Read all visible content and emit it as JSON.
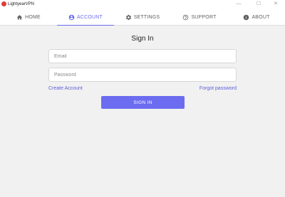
{
  "window": {
    "title": "LightyearVPN",
    "controls": {
      "minimize": "—",
      "maximize": "☐",
      "close": "✕"
    }
  },
  "nav": {
    "tabs": [
      {
        "label": "HOME",
        "icon": "home-icon"
      },
      {
        "label": "ACCOUNT",
        "icon": "account-circle-icon",
        "active": true
      },
      {
        "label": "SETTINGS",
        "icon": "gear-icon"
      },
      {
        "label": "SUPPORT",
        "icon": "help-circle-icon"
      },
      {
        "label": "ABOUT",
        "icon": "info-icon"
      }
    ]
  },
  "signin": {
    "title": "Sign In",
    "email_placeholder": "Email",
    "email_value": "",
    "password_placeholder": "Password",
    "password_value": "",
    "create_account": "Create Account",
    "forgot_password": "Forgot password",
    "button": "SIGN IN"
  },
  "colors": {
    "accent": "#6b6cf0",
    "link": "#5b5fd8",
    "background": "#f1f1f1",
    "logo": "#e23b3b"
  }
}
